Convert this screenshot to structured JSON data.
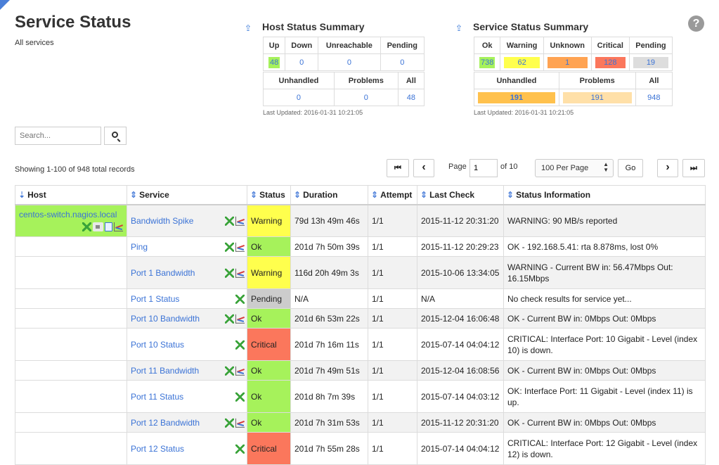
{
  "page": {
    "title": "Service Status",
    "subtitle": "All services"
  },
  "host_summary": {
    "title": "Host Status Summary",
    "headers": [
      "Up",
      "Down",
      "Unreachable",
      "Pending"
    ],
    "values": [
      "48",
      "0",
      "0",
      "0"
    ],
    "headers2": [
      "Unhandled",
      "Problems",
      "All"
    ],
    "values2": [
      "0",
      "0",
      "48"
    ],
    "updated": "Last Updated: 2016-01-31 10:21:05"
  },
  "service_summary": {
    "title": "Service Status Summary",
    "headers": [
      "Ok",
      "Warning",
      "Unknown",
      "Critical",
      "Pending"
    ],
    "values": [
      "738",
      "62",
      "1",
      "128",
      "19"
    ],
    "headers2": [
      "Unhandled",
      "Problems",
      "All"
    ],
    "values2": [
      "191",
      "191",
      "948"
    ],
    "updated": "Last Updated: 2016-01-31 10:21:05"
  },
  "search": {
    "placeholder": "Search..."
  },
  "records_text": "Showing 1-100 of 948 total records",
  "pagination": {
    "page_label": "Page",
    "page_value": "1",
    "of_label": "of 10",
    "per_page": "100 Per Page",
    "go_label": "Go",
    "first_glyph": "⏮",
    "prev_glyph": "‹",
    "next_glyph": "›",
    "last_glyph": "⏭"
  },
  "columns": {
    "host": "Host",
    "service": "Service",
    "status": "Status",
    "duration": "Duration",
    "attempt": "Attempt",
    "last_check": "Last Check",
    "info": "Status Information"
  },
  "colors": {
    "ok": "#a6f25b",
    "warning": "#ffff4d",
    "critical": "#fb775c",
    "pending": "#cccccc",
    "unknown": "#ffa352",
    "link": "#3b73d6"
  },
  "host_name": "centos-switch.nagios.local",
  "rows": [
    {
      "service": "Bandwidth Spike",
      "status": "Warning",
      "duration": "79d 13h 49m 46s",
      "attempt": "1/1",
      "last_check": "2015-11-12 20:31:20",
      "info": "WARNING: 90 MB/s reported"
    },
    {
      "service": "Ping",
      "status": "Ok",
      "duration": "201d 7h 50m 39s",
      "attempt": "1/1",
      "last_check": "2015-11-12 20:29:23",
      "info": "OK - 192.168.5.41: rta 8.878ms, lost 0%"
    },
    {
      "service": "Port 1 Bandwidth",
      "status": "Warning",
      "duration": "116d 20h 49m 3s",
      "attempt": "1/1",
      "last_check": "2015-10-06 13:34:05",
      "info": "WARNING - Current BW in: 56.47Mbps Out: 16.15Mbps"
    },
    {
      "service": "Port 1 Status",
      "status": "Pending",
      "duration": "N/A",
      "attempt": "1/1",
      "last_check": "N/A",
      "info": "No check results for service yet..."
    },
    {
      "service": "Port 10 Bandwidth",
      "status": "Ok",
      "duration": "201d 6h 53m 22s",
      "attempt": "1/1",
      "last_check": "2015-12-04 16:06:48",
      "info": "OK - Current BW in: 0Mbps Out: 0Mbps"
    },
    {
      "service": "Port 10 Status",
      "status": "Critical",
      "duration": "201d 7h 16m 11s",
      "attempt": "1/1",
      "last_check": "2015-07-14 04:04:12",
      "info": "CRITICAL: Interface Port: 10 Gigabit - Level (index 10) is down."
    },
    {
      "service": "Port 11 Bandwidth",
      "status": "Ok",
      "duration": "201d 7h 49m 51s",
      "attempt": "1/1",
      "last_check": "2015-12-04 16:08:56",
      "info": "OK - Current BW in: 0Mbps Out: 0Mbps"
    },
    {
      "service": "Port 11 Status",
      "status": "Ok",
      "duration": "201d 8h 7m 39s",
      "attempt": "1/1",
      "last_check": "2015-07-14 04:03:12",
      "info": "OK: Interface Port: 11 Gigabit - Level (index 11) is up."
    },
    {
      "service": "Port 12 Bandwidth",
      "status": "Ok",
      "duration": "201d 7h 31m 53s",
      "attempt": "1/1",
      "last_check": "2015-11-12 20:31:20",
      "info": "OK - Current BW in: 0Mbps Out: 0Mbps"
    },
    {
      "service": "Port 12 Status",
      "status": "Critical",
      "duration": "201d 7h 55m 28s",
      "attempt": "1/1",
      "last_check": "2015-07-14 04:04:12",
      "info": "CRITICAL: Interface Port: 12 Gigabit - Level (index 12) is down."
    }
  ]
}
